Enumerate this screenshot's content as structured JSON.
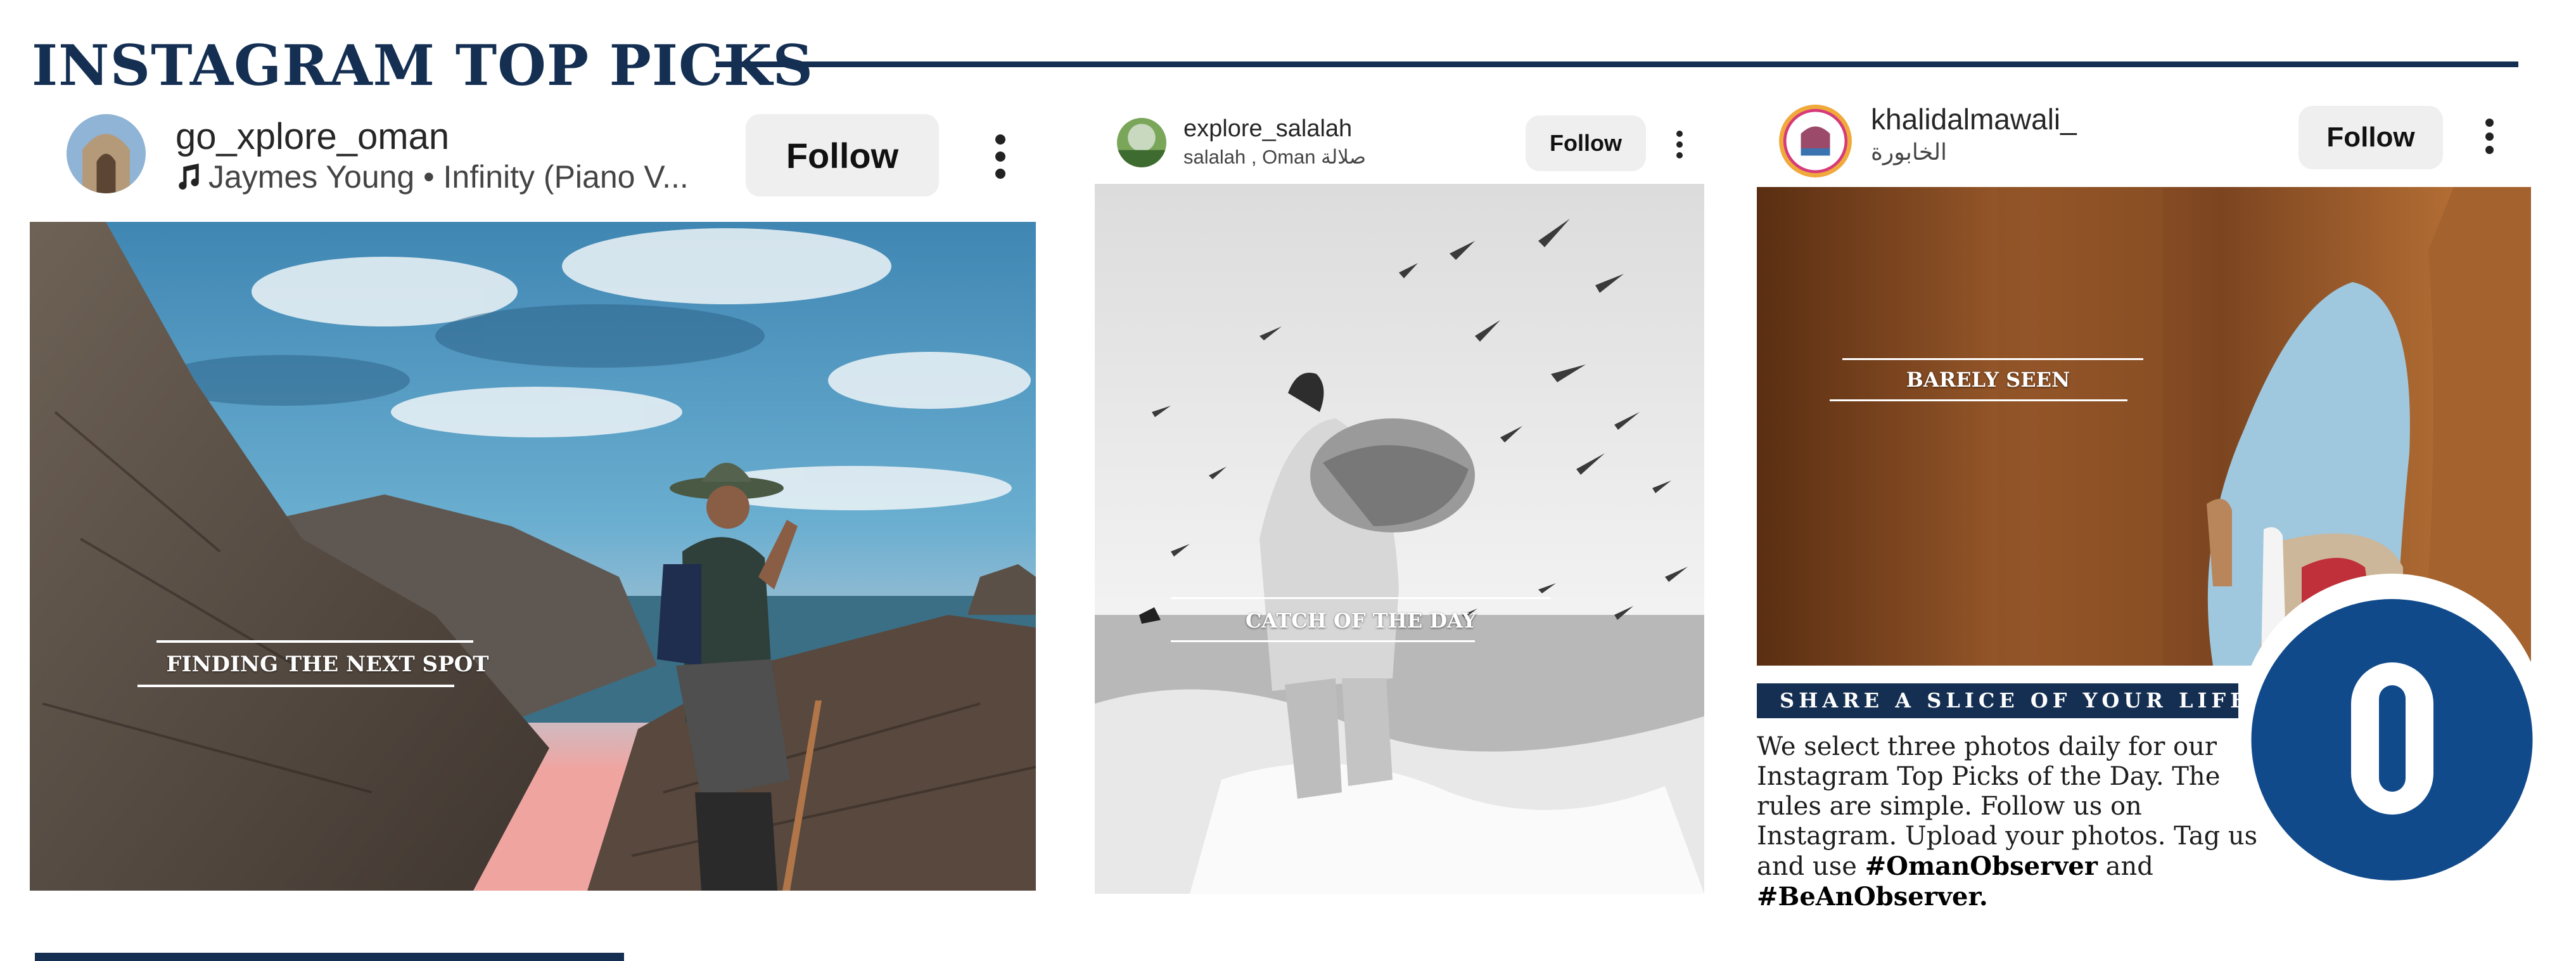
{
  "page_title": "INSTAGRAM TOP PICKS",
  "colors": {
    "brand_navy": "#142f52",
    "logo_blue": "#114a8b"
  },
  "posts": [
    {
      "username": "go_xplore_oman",
      "subtitle": "Jaymes Young • Infinity (Piano V...",
      "subtitle_icon": "music-note-icon",
      "follow_label": "Follow",
      "caption": "FINDING THE NEXT SPOT"
    },
    {
      "username": "explore_salalah",
      "subtitle": "salalah , Oman صلالة",
      "follow_label": "Follow",
      "caption": "CATCH OF THE DAY"
    },
    {
      "username": "khalidalmawali_",
      "subtitle": "الخابورة",
      "follow_label": "Follow",
      "caption": "BARELY SEEN"
    }
  ],
  "promo": {
    "banner": "SHARE A SLICE OF YOUR LIFE",
    "text_before": "We select three photos daily for our Instagram Top Picks of the Day. The rules are simple. Follow us on Instagram. Upload your photos. Tag us and use ",
    "hashtag_1": "#OmanObserver",
    "text_between": " and ",
    "hashtag_2": "#BeAnObserver."
  },
  "logo_letter": "O"
}
